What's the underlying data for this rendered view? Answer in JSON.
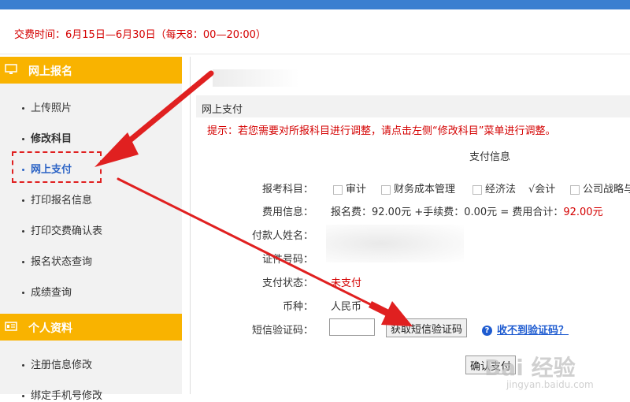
{
  "notice": "交费时间：6月15日—6月30日（每天8：00—20:00）",
  "sidebar": {
    "section1_title": "网上报名",
    "items": [
      {
        "label": "上传照片"
      },
      {
        "label": "修改科目"
      },
      {
        "label": "网上支付"
      },
      {
        "label": "打印报名信息"
      },
      {
        "label": "打印交费确认表"
      },
      {
        "label": "报名状态查询"
      },
      {
        "label": "成绩查询"
      }
    ],
    "section2_title": "个人资料",
    "items2": [
      {
        "label": "注册信息修改"
      },
      {
        "label": "绑定手机号修改"
      }
    ]
  },
  "panel": {
    "title": "网上支付",
    "tip": "提示：若您需要对所报科目进行调整，请点击左侧“修改科目”菜单进行调整。",
    "section_title": "支付信息"
  },
  "form": {
    "subjects_label": "报考科目：",
    "subjects": [
      {
        "name": "审计",
        "checked": false
      },
      {
        "name": "财务成本管理",
        "checked": false
      },
      {
        "name": "经济法",
        "checked": false
      },
      {
        "name": "会计",
        "checked": true
      },
      {
        "name": "公司战略与",
        "checked": false
      }
    ],
    "checked_mark": "√",
    "fee_label": "费用信息：",
    "fee_text": "报名费：92.00元 +手续费：0.00元 = 费用合计：",
    "fee_total": "92.00元",
    "payer_label": "付款人姓名：",
    "id_label": "证件号码：",
    "status_label": "支付状态：",
    "status_value": "未支付",
    "currency_label": "币种：",
    "currency_value": "人民币",
    "sms_label": "短信验证码：",
    "sms_value": "",
    "get_code_button": "获取短信验证码",
    "help_link": "收不到验证码？",
    "help_icon": "?",
    "confirm_button": "确认支付"
  },
  "watermark": {
    "main": "Bai 经验",
    "sub": "jingyan.baidu.com"
  },
  "colors": {
    "top_bar": "#3a7fd0",
    "section_header": "#f9b300",
    "alert_red": "#d40000",
    "active_link": "#2b63c5",
    "annotation_red": "#e02020"
  }
}
